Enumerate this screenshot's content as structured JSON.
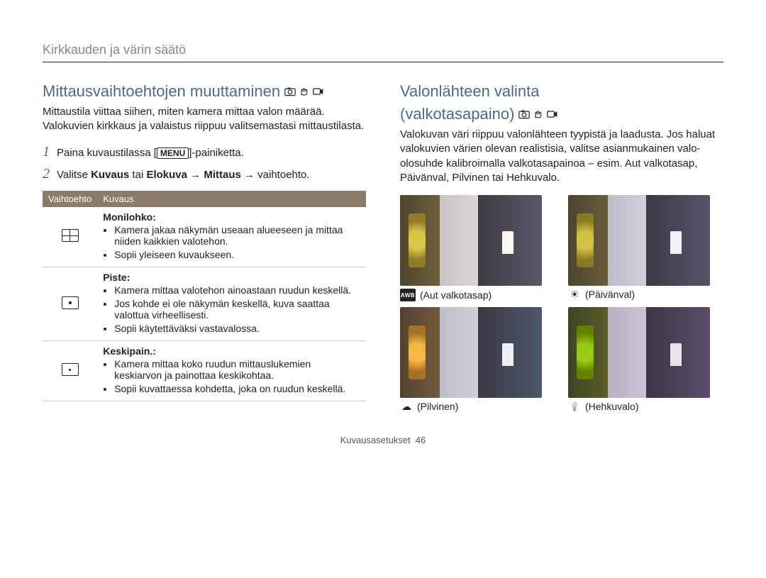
{
  "breadcrumb": "Kirkkauden ja värin säätö",
  "left": {
    "title": "Mittausvaihtoehtojen muuttaminen",
    "intro": "Mittaustila viittaa siihen, miten kamera mittaa valon määrää. Valokuvien kirkkaus ja valaistus riippuu valitsemastasi mittaustilasta.",
    "steps": [
      {
        "num": "1",
        "pre": "Paina kuvaustilassa [",
        "menu": "MENU",
        "post": "]-painiketta."
      },
      {
        "num": "2",
        "pre": "Valitse ",
        "b1": "Kuvaus",
        "mid1": " tai ",
        "b2": "Elokuva",
        "mid2": " → ",
        "b3": "Mittaus",
        "post": " → vaihtoehto."
      }
    ],
    "table": {
      "th_option": "Vaihtoehto",
      "th_desc": "Kuvaus",
      "rows": [
        {
          "icon": "multi",
          "title": "Monilohko:",
          "items": [
            "Kamera jakaa näkymän useaan alueeseen ja mittaa niiden kaikkien valotehon.",
            "Sopii yleiseen kuvaukseen."
          ]
        },
        {
          "icon": "dot",
          "title": "Piste:",
          "items": [
            "Kamera mittaa valotehon ainoastaan ruudun keskellä.",
            "Jos kohde ei ole näkymän keskellä, kuva saattaa valottua virheellisesti.",
            "Sopii käytettäväksi vastavalossa."
          ]
        },
        {
          "icon": "center",
          "title": "Keskipain.:",
          "items": [
            "Kamera mittaa koko ruudun mittauslukemien keskiarvon ja painottaa keskikohtaa.",
            "Sopii kuvattaessa kohdetta, joka on ruudun keskellä."
          ]
        }
      ]
    }
  },
  "right": {
    "title_l1": "Valonlähteen valinta",
    "title_l2": "(valkotasapaino)",
    "intro": "Valokuvan väri riippuu valonlähteen tyypistä ja laadusta. Jos haluat valokuvien värien olevan realistisia, valitse asianmukainen valo-olosuhde kalibroimalla valkotasapainoa – esim. Aut valkotasap, Päivänval, Pilvinen tai Hehkuvalo.",
    "items": [
      {
        "icon": "awb",
        "label": "(Aut valkotasap)",
        "tone": "warm"
      },
      {
        "icon": "sun",
        "label": "(Päivänval)",
        "tone": ""
      },
      {
        "icon": "cloud",
        "label": "(Pilvinen)",
        "tone": "cool"
      },
      {
        "icon": "bulb",
        "label": "(Hehkuvalo)",
        "tone": "bluish"
      }
    ]
  },
  "footer": {
    "section": "Kuvausasetukset",
    "page": "46"
  },
  "icons": {
    "awb_text": "AWB"
  }
}
